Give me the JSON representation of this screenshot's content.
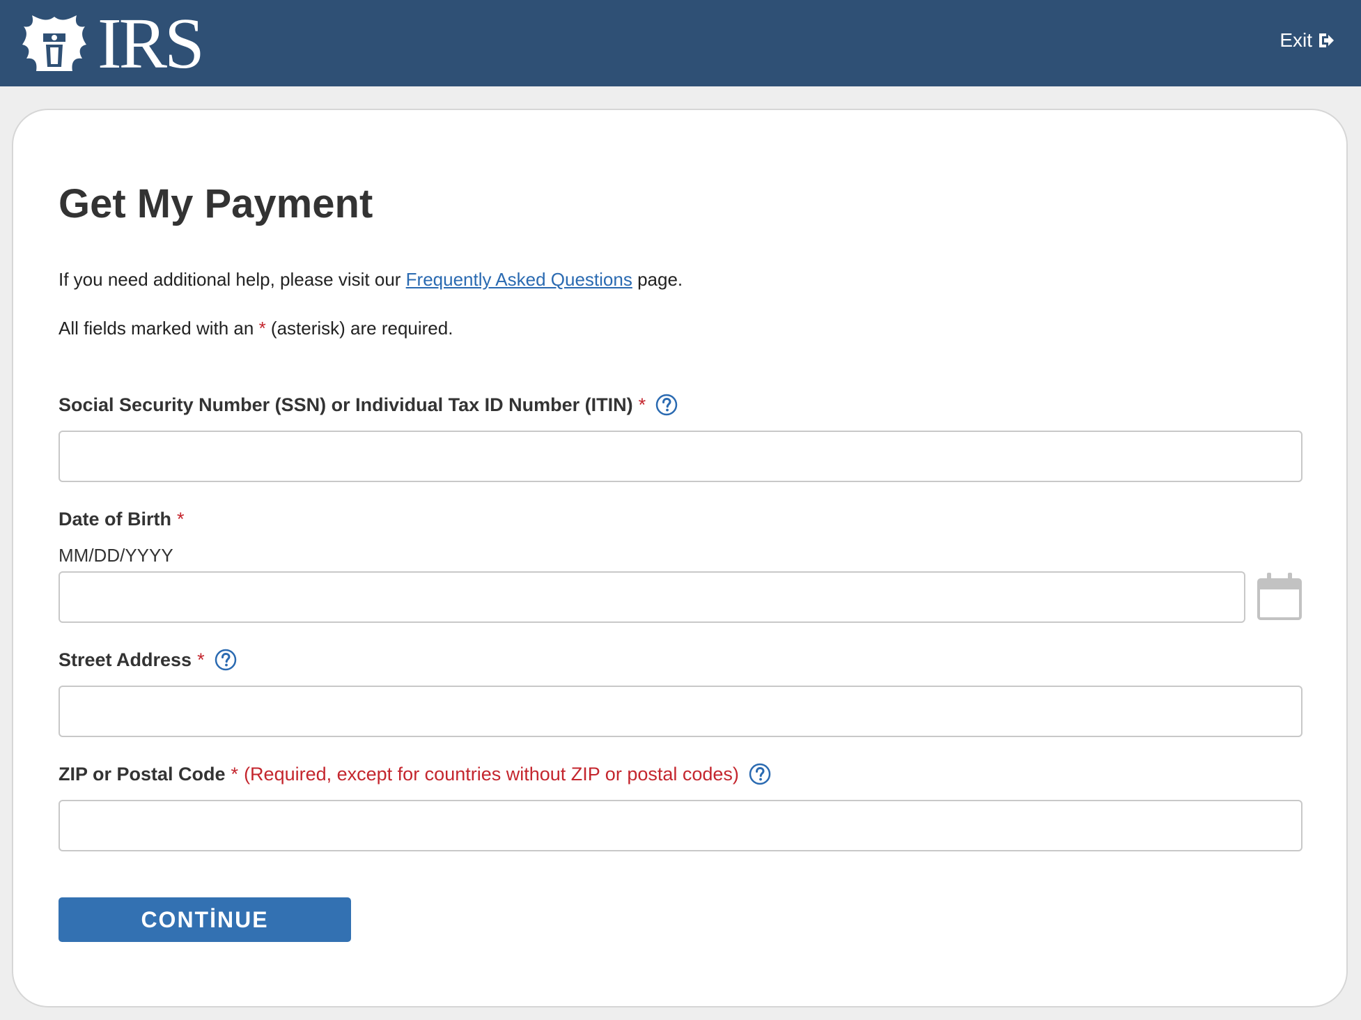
{
  "header": {
    "logo_text": "IRS",
    "exit_label": "Exit"
  },
  "page": {
    "title": "Get My Payment",
    "help_prefix": "If you need additional help, please visit our ",
    "help_link": "Frequently Asked Questions",
    "help_suffix": " page.",
    "required_prefix": "All fields marked with an ",
    "required_star": "*",
    "required_suffix": " (asterisk) are required."
  },
  "form": {
    "ssn_label": "Social Security Number (SSN) or Individual Tax ID Number (ITIN)",
    "dob_label": "Date of Birth",
    "dob_hint": "MM/DD/YYYY",
    "street_label": "Street Address",
    "zip_label": "ZIP or Postal Code",
    "zip_note": "(Required, except for countries without ZIP or postal codes)",
    "required_marker": "*",
    "continue_label": "CONTİNUE"
  },
  "colors": {
    "header_bg": "#2f5075",
    "link": "#2a6ab1",
    "required": "#c4262e",
    "button_bg": "#3371b2"
  }
}
